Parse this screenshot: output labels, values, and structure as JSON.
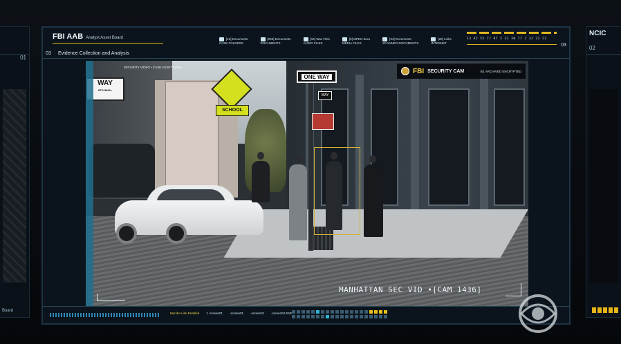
{
  "left_monitor": {
    "number": "01",
    "footer": "Board"
  },
  "right_monitor": {
    "title": "NCIC",
    "number": "02"
  },
  "main": {
    "brand": "FBI AAB",
    "brand_sub": "Analyst Asset Board",
    "corner_left": "03",
    "corner_right": "03",
    "subtitle": "Evidence Collection and Analysis",
    "tabs": [
      {
        "count": "[16] Documents",
        "label": "CASE FOLDERS"
      },
      {
        "count": "[265] Documents",
        "label": "DOCUMENTS"
      },
      {
        "count": "[16] Wav Files",
        "label": "AUDIO FILES"
      },
      {
        "count": "[6] MPEG docs",
        "label": "MEDIA FILES"
      },
      {
        "count": "[34] Documents",
        "label": "SCANNED DOCUMENTS"
      },
      {
        "count": "[28] Links",
        "label": "INTERNET"
      }
    ],
    "clock_digits": "13 42 55 77   97 2 32 30 77   1 32 32 22"
  },
  "video": {
    "security_label": "SECURITY VIDEO • CASE ASSET 94598",
    "cam_brand": "FBI",
    "cam_title": "SECURITY CAM",
    "cam_status": "0/1 ARCHIVED  ENCRYPTED",
    "caption": "MANHATTAN SEC VID •[CAM 1436]",
    "signs": {
      "one_way": "ONE WAY",
      "way": "WAY",
      "way_sub": "STD 5849 •",
      "school": "SCHOOL",
      "small": "WAY"
    }
  },
  "bottombar": {
    "status_items": [
      "Monitor Link Enabled",
      "1 -screen01",
      "-screen01",
      "-screen01",
      "-screen04 END"
    ]
  },
  "colors": {
    "accent_yellow": "#e0b521",
    "frame_blue": "#1e3446",
    "tick_blue": "#2f87b5"
  },
  "watermark": "CBS"
}
